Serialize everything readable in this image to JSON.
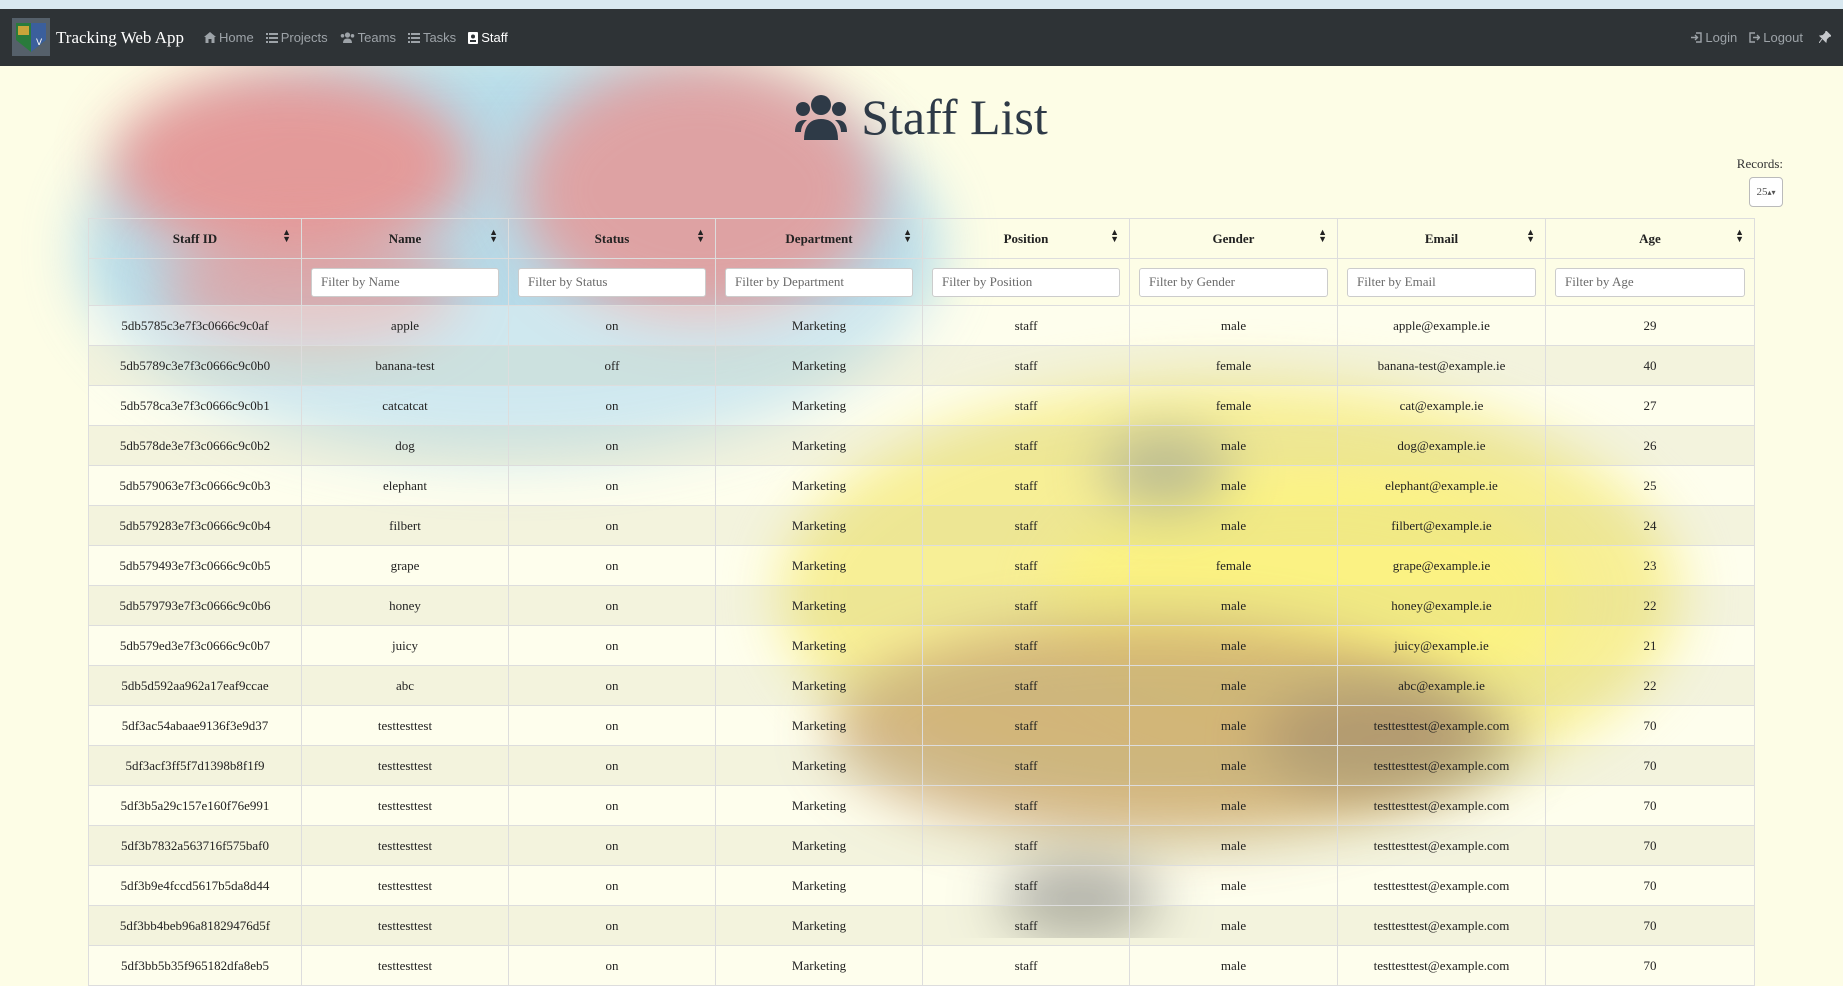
{
  "app": {
    "title": "Tracking Web App"
  },
  "nav": {
    "home": "Home",
    "projects": "Projects",
    "teams": "Teams",
    "tasks": "Tasks",
    "staff": "Staff",
    "login": "Login",
    "logout": "Logout"
  },
  "page": {
    "title": "Staff List"
  },
  "records": {
    "label": "Records:",
    "value": "25"
  },
  "table": {
    "headers": [
      "Staff ID",
      "Name",
      "Status",
      "Department",
      "Position",
      "Gender",
      "Email",
      "Age"
    ],
    "filters": [
      "Filter by Name",
      "Filter by Status",
      "Filter by Department",
      "Filter by Position",
      "Filter by Gender",
      "Filter by Email",
      "Filter by Age"
    ],
    "rows": [
      [
        "5db5785c3e7f3c0666c9c0af",
        "apple",
        "on",
        "Marketing",
        "staff",
        "male",
        "apple@example.ie",
        "29"
      ],
      [
        "5db5789c3e7f3c0666c9c0b0",
        "banana-test",
        "off",
        "Marketing",
        "staff",
        "female",
        "banana-test@example.ie",
        "40"
      ],
      [
        "5db578ca3e7f3c0666c9c0b1",
        "catcatcat",
        "on",
        "Marketing",
        "staff",
        "female",
        "cat@example.ie",
        "27"
      ],
      [
        "5db578de3e7f3c0666c9c0b2",
        "dog",
        "on",
        "Marketing",
        "staff",
        "male",
        "dog@example.ie",
        "26"
      ],
      [
        "5db579063e7f3c0666c9c0b3",
        "elephant",
        "on",
        "Marketing",
        "staff",
        "male",
        "elephant@example.ie",
        "25"
      ],
      [
        "5db579283e7f3c0666c9c0b4",
        "filbert",
        "on",
        "Marketing",
        "staff",
        "male",
        "filbert@example.ie",
        "24"
      ],
      [
        "5db579493e7f3c0666c9c0b5",
        "grape",
        "on",
        "Marketing",
        "staff",
        "female",
        "grape@example.ie",
        "23"
      ],
      [
        "5db579793e7f3c0666c9c0b6",
        "honey",
        "on",
        "Marketing",
        "staff",
        "male",
        "honey@example.ie",
        "22"
      ],
      [
        "5db579ed3e7f3c0666c9c0b7",
        "juicy",
        "on",
        "Marketing",
        "staff",
        "male",
        "juicy@example.ie",
        "21"
      ],
      [
        "5db5d592aa962a17eaf9ccae",
        "abc",
        "on",
        "Marketing",
        "staff",
        "male",
        "abc@example.ie",
        "22"
      ],
      [
        "5df3ac54abaae9136f3e9d37",
        "testtesttest",
        "on",
        "Marketing",
        "staff",
        "male",
        "testtesttest@example.com",
        "70"
      ],
      [
        "5df3acf3ff5f7d1398b8f1f9",
        "testtesttest",
        "on",
        "Marketing",
        "staff",
        "male",
        "testtesttest@example.com",
        "70"
      ],
      [
        "5df3b5a29c157e160f76e991",
        "testtesttest",
        "on",
        "Marketing",
        "staff",
        "male",
        "testtesttest@example.com",
        "70"
      ],
      [
        "5df3b7832a563716f575baf0",
        "testtesttest",
        "on",
        "Marketing",
        "staff",
        "male",
        "testtesttest@example.com",
        "70"
      ],
      [
        "5df3b9e4fccd5617b5da8d44",
        "testtesttest",
        "on",
        "Marketing",
        "staff",
        "male",
        "testtesttest@example.com",
        "70"
      ],
      [
        "5df3bb4beb96a81829476d5f",
        "testtesttest",
        "on",
        "Marketing",
        "staff",
        "male",
        "testtesttest@example.com",
        "70"
      ],
      [
        "5df3bb5b35f965182dfa8eb5",
        "testtesttest",
        "on",
        "Marketing",
        "staff",
        "male",
        "testtesttest@example.com",
        "70"
      ]
    ]
  }
}
